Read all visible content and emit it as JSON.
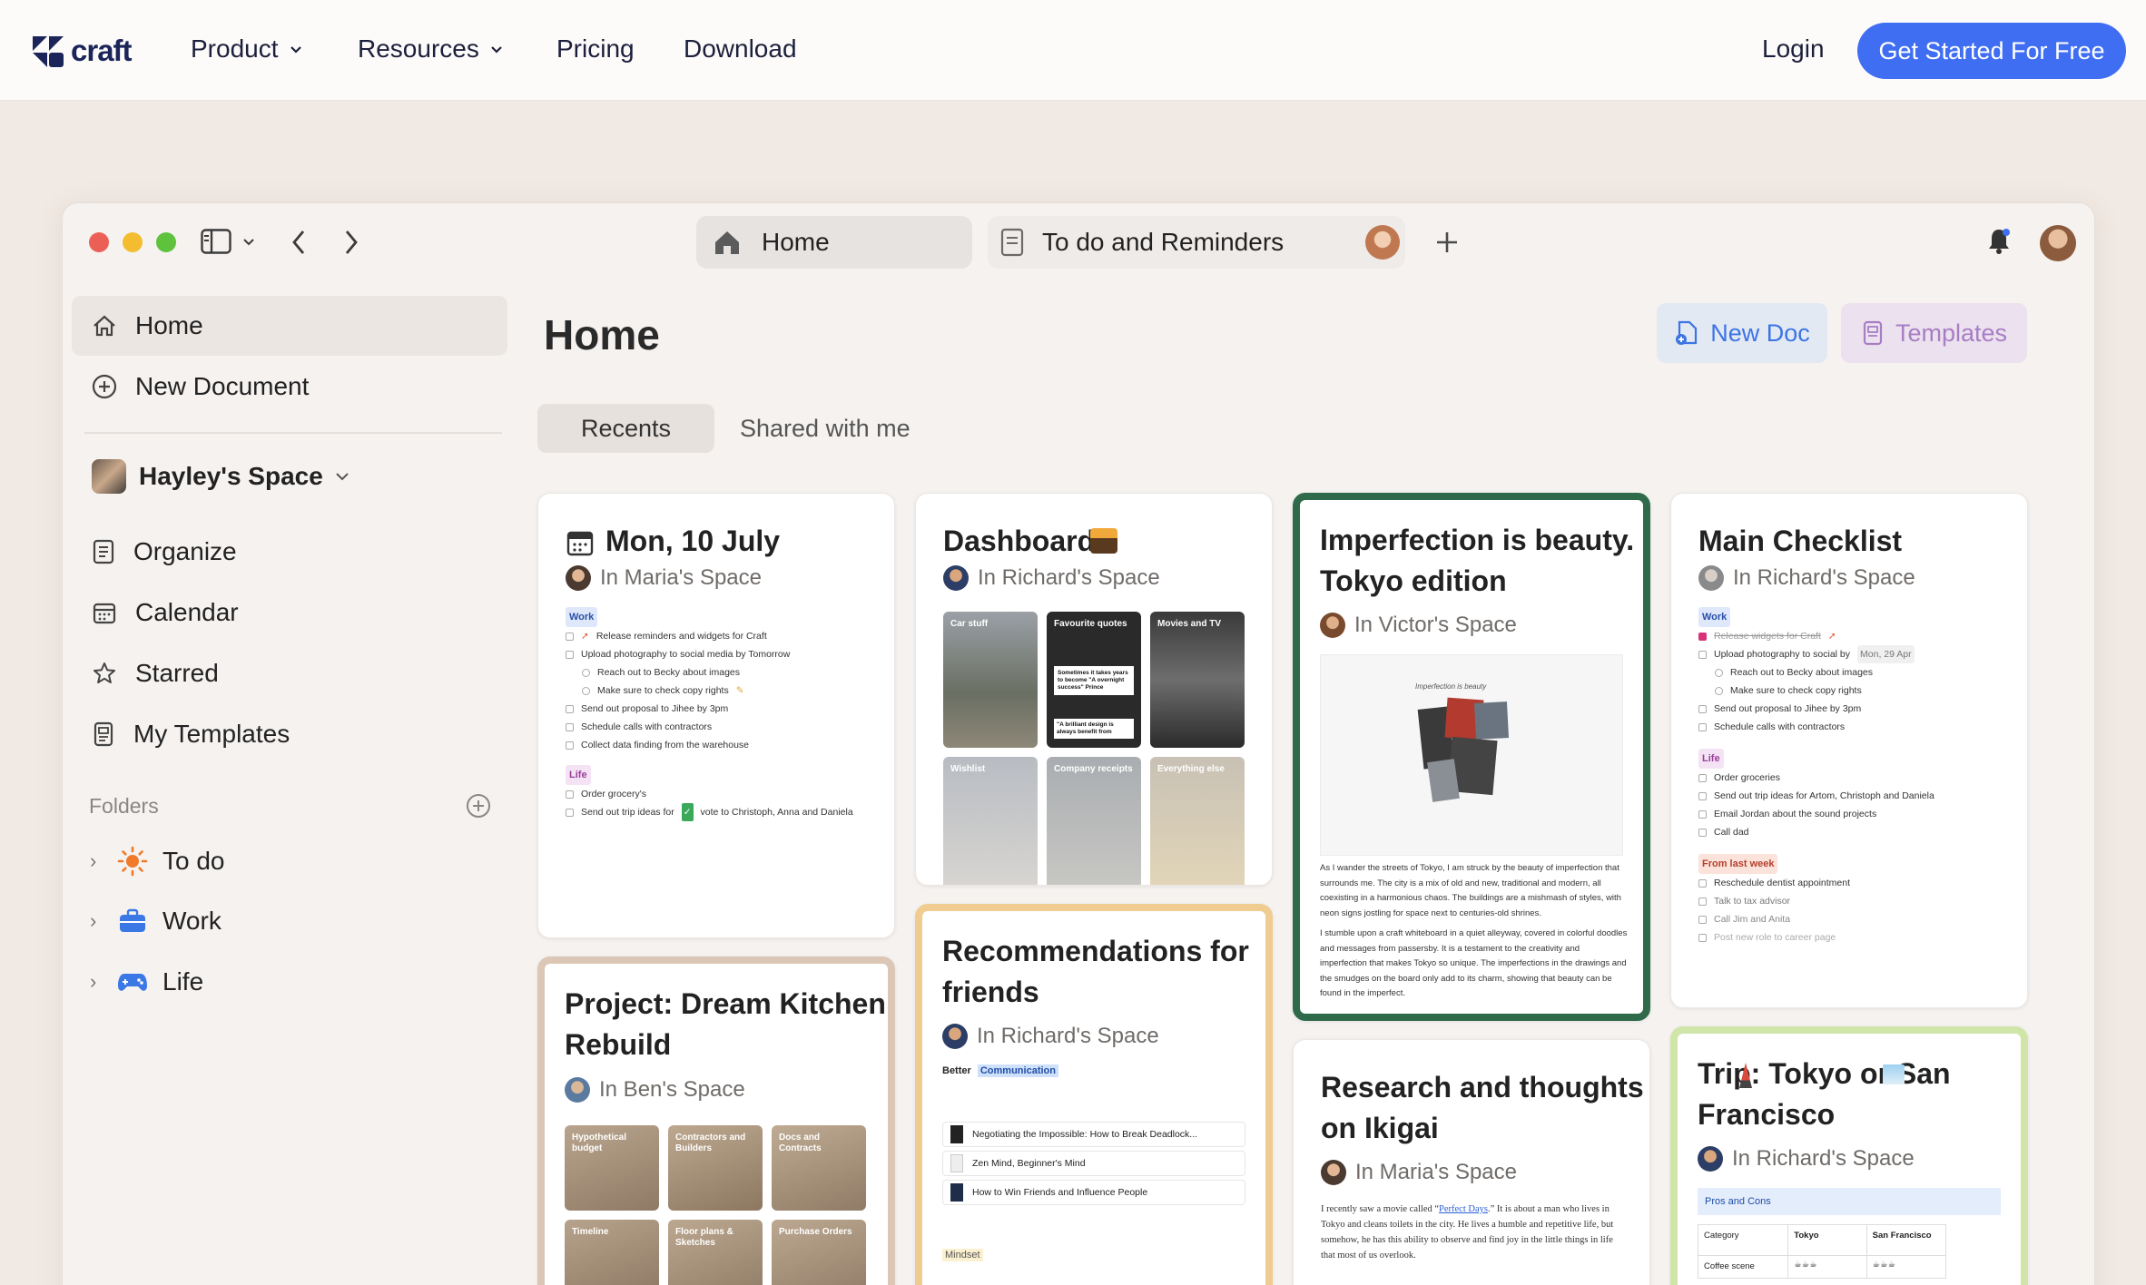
{
  "site": {
    "logo": "craft",
    "nav": [
      "Product",
      "Resources",
      "Pricing",
      "Download"
    ],
    "login": "Login",
    "cta": "Get Started For Free"
  },
  "tabs": {
    "home": "Home",
    "todo": "To do and Reminders"
  },
  "sidebar": {
    "home": "Home",
    "new_document": "New Document",
    "space": "Hayley's Space",
    "organize": "Organize",
    "calendar": "Calendar",
    "starred": "Starred",
    "my_templates": "My Templates",
    "folders_label": "Folders",
    "folders": [
      "To do",
      "Work",
      "Life"
    ]
  },
  "main": {
    "title": "Home",
    "new_doc": "New Doc",
    "templates": "Templates",
    "recents": "Recents",
    "shared": "Shared with me"
  },
  "cards": {
    "mon": {
      "title": "Mon, 10 July",
      "space": "In Maria's Space",
      "tag_work": "Work",
      "work_items": [
        "Release reminders and widgets for Craft",
        "Upload photography to social media by Tomorrow",
        "Reach out to Becky about images",
        "Make sure to check copy rights",
        "Send out proposal to Jihee by 3pm",
        "Schedule calls with contractors",
        "Collect data finding from the warehouse"
      ],
      "tag_life": "Life",
      "life_items": [
        "Order grocery's",
        "Send out trip ideas for",
        "vote to Christoph, Anna and Daniela"
      ]
    },
    "dashboard": {
      "title": "Dashboard",
      "space": "In Richard's Space",
      "tiles": [
        "Car stuff",
        "Favourite quotes",
        "Movies and TV",
        "Wishlist",
        "Company receipts",
        "Everything else"
      ],
      "quote1": "Sometimes it takes years to become \"A overnight success\" Prince",
      "quote2": "\"A brilliant design is always benefit from"
    },
    "imperfection": {
      "title_1": "Imperfection is beauty.",
      "title_2": "Tokyo edition",
      "space": "In Victor's Space",
      "caption": "Imperfection is beauty",
      "para1": "As I wander the streets of Tokyo, I am struck by the beauty of imperfection that surrounds me. The city is a mix of old and new, traditional and modern, all coexisting in a harmonious chaos. The buildings are a mishmash of styles, with neon signs jostling for space next to centuries-old shrines.",
      "para2": "I stumble upon a craft whiteboard in a quiet alleyway, covered in colorful doodles and messages from passersby. It is a testament to the creativity and imperfection that makes Tokyo so unique. The imperfections in the drawings and the smudges on the board only add to its charm, showing that beauty can be found in the imperfect."
    },
    "checklist": {
      "title": "Main Checklist",
      "space": "In Richard's Space",
      "tag_work": "Work",
      "work_items": [
        "Release widgets for Craft",
        "Upload photography to social by",
        "Reach out to Becky about images",
        "Make sure to check copy rights",
        "Send out proposal to Jihee by 3pm",
        "Schedule calls with contractors"
      ],
      "date_chip": "Mon, 29 Apr",
      "tag_life": "Life",
      "life_items": [
        "Order groceries",
        "Send out trip ideas for Artom, Christoph and Daniela",
        "Email Jordan about the sound projects",
        "Call dad"
      ],
      "tag_last": "From last week",
      "last_items": [
        "Reschedule dentist appointment",
        "Talk to tax advisor",
        "Call Jim and Anita",
        "Post new role to career page"
      ]
    },
    "recommendations": {
      "title_1": "Recommendations for",
      "title_2": "friends",
      "space": "In Richard's Space",
      "label": "Better",
      "highlight": "Communication",
      "books": [
        "Negotiating the Impossible: How to Break Deadlock...",
        "Zen Mind, Beginner's Mind",
        "How to Win Friends and Influence People"
      ],
      "mindset": "Mindset"
    },
    "kitchen": {
      "title_1": "Project: Dream Kitchen",
      "title_2": "Rebuild",
      "space": "In Ben's Space",
      "tiles": [
        "Hypothetical budget",
        "Contractors and Builders",
        "Docs and Contracts",
        "Timeline",
        "Floor plans & Sketches",
        "Purchase Orders"
      ]
    },
    "ikigai": {
      "title_1": "Research and thoughts",
      "title_2": "on Ikigai",
      "space": "In Maria's Space",
      "para_start": "I recently saw a movie called “",
      "link": "Perfect Days",
      "para_end": ".” It is about a man who lives in Tokyo and cleans toilets in the city. He lives a humble and repetitive life, but somehow, he has this ability to observe and find joy in the little things in life that most of us overlook."
    },
    "trip": {
      "title_1": "Trip: Tokyo or San",
      "title_2": "Francisco",
      "space": "In Richard's Space",
      "pros": "Pros and Cons",
      "col_category": "Category",
      "col_tokyo": "Tokyo",
      "col_sf": "San Francisco",
      "row1": "Coffee scene"
    }
  },
  "colors": {
    "accent": "#3f6ef3",
    "imperfection_border": "#2f6b4a",
    "recommend_border": "#f0c98a",
    "trip_border": "#cfe6a8",
    "kitchen_border": "#d8c1b0"
  }
}
